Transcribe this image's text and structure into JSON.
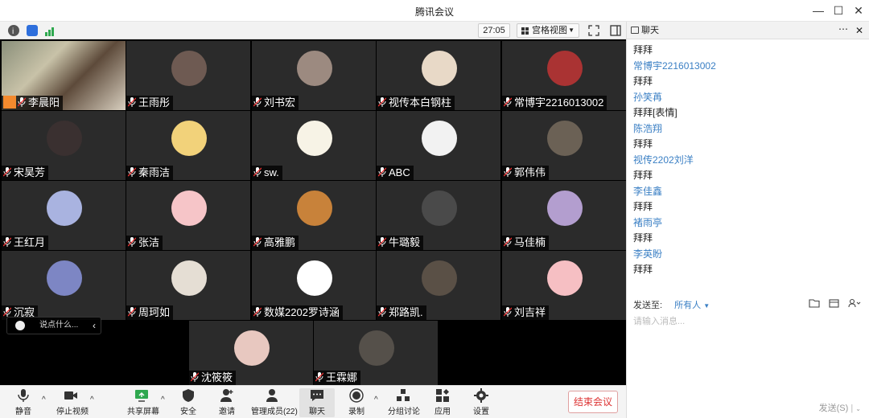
{
  "window": {
    "title": "腾讯会议"
  },
  "topbar": {
    "timer": "27:05",
    "view_label": "宫格视图"
  },
  "tiles": [
    {
      "name": "李晨阳",
      "self": true
    },
    {
      "name": "王雨彤",
      "color": "#6e5a52"
    },
    {
      "name": "刘书宏",
      "color": "#9c8a80"
    },
    {
      "name": "视传本白钢柱",
      "color": "#e8d9c7"
    },
    {
      "name": "常博宇2216013002",
      "color": "#a33"
    },
    {
      "name": "宋昊芳",
      "color": "#3a3030"
    },
    {
      "name": "秦雨洁",
      "color": "#f2d27a"
    },
    {
      "name": "sw.",
      "color": "#f7f3e6"
    },
    {
      "name": "ABC",
      "color": "#f2f2f2"
    },
    {
      "name": "郭伟伟",
      "color": "#6b6155"
    },
    {
      "name": "王红月",
      "color": "#a9b3e0"
    },
    {
      "name": "张洁",
      "color": "#f6c5c8"
    },
    {
      "name": "高雅鹏",
      "color": "#c8823a"
    },
    {
      "name": "牛璐毅",
      "color": "#4a4a4a"
    },
    {
      "name": "马佳楠",
      "color": "#b39ecf"
    },
    {
      "name": "沉寂",
      "color": "#7d86c4"
    },
    {
      "name": "周珂如",
      "color": "#e5ded4"
    },
    {
      "name": "数媒2202罗诗涵",
      "color": "#ffffff"
    },
    {
      "name": "郑路凯.",
      "color": "#5a5046"
    },
    {
      "name": "刘吉祥",
      "color": "#f6bfc3"
    },
    {
      "name": "沈筱筱",
      "color": "#e8c8c0"
    },
    {
      "name": "王霖娜",
      "color": "#55504a"
    }
  ],
  "chat_overlay": {
    "placeholder": "说点什么..."
  },
  "toolbar": {
    "mute": "静音",
    "stop_video": "停止视频",
    "share": "共享屏幕",
    "security": "安全",
    "invite": "邀请",
    "members": "管理成员(22)",
    "chat": "聊天",
    "record": "录制",
    "breakout": "分组讨论",
    "apps": "应用",
    "settings": "设置",
    "end": "结束会议"
  },
  "chat_panel": {
    "title": "聊天",
    "messages": [
      {
        "type": "text",
        "text": "拜拜"
      },
      {
        "type": "sender",
        "text": "常博宇2216013002"
      },
      {
        "type": "text",
        "text": "拜拜"
      },
      {
        "type": "sender",
        "text": "孙笑苒"
      },
      {
        "type": "text",
        "text": "拜拜[表情]"
      },
      {
        "type": "sender",
        "text": "陈浩翔"
      },
      {
        "type": "text",
        "text": "拜拜"
      },
      {
        "type": "sender",
        "text": "视传2202刘洋"
      },
      {
        "type": "text",
        "text": "拜拜"
      },
      {
        "type": "sender",
        "text": "李佳鑫"
      },
      {
        "type": "text",
        "text": "拜拜"
      },
      {
        "type": "sender",
        "text": "褚雨亭"
      },
      {
        "type": "text",
        "text": "拜拜"
      },
      {
        "type": "sender",
        "text": "李英盼"
      },
      {
        "type": "text",
        "text": "拜拜"
      }
    ],
    "send_to_label": "发送至:",
    "send_to_value": "所有人",
    "input_placeholder": "请输入消息...",
    "send_label": "发送(S)"
  }
}
